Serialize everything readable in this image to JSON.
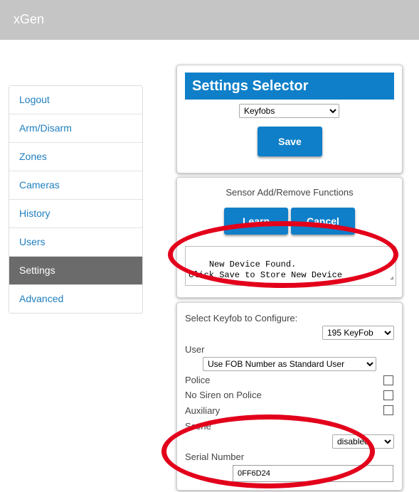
{
  "app": {
    "title": "xGen"
  },
  "sidebar": {
    "items": [
      {
        "label": "Logout"
      },
      {
        "label": "Arm/Disarm"
      },
      {
        "label": "Zones"
      },
      {
        "label": "Cameras"
      },
      {
        "label": "History"
      },
      {
        "label": "Users"
      },
      {
        "label": "Settings",
        "active": true
      },
      {
        "label": "Advanced"
      }
    ]
  },
  "settings_selector": {
    "title": "Settings Selector",
    "selected": "Keyfobs",
    "save_label": "Save"
  },
  "sensor": {
    "title": "Sensor Add/Remove Functions",
    "learn_label": "Learn",
    "cancel_label": "Cancel",
    "message": "New Device Found.\nClick Save to Store New Device"
  },
  "keyfob": {
    "select_label": "Select Keyfob to Configure:",
    "selected_fob": "195 KeyFob",
    "user_label": "User",
    "user_selected": "Use FOB Number as Standard User",
    "police_label": "Police",
    "no_siren_label": "No Siren on Police",
    "auxiliary_label": "Auxiliary",
    "scene_label": "Scene",
    "scene_selected": "disabled",
    "serial_label": "Serial Number",
    "serial_value": "0FF6D24"
  },
  "colors": {
    "accent": "#0f7fc9",
    "active_nav": "#6b6b6b",
    "annotation": "#e3001b",
    "topbar": "#c5c5c5"
  }
}
